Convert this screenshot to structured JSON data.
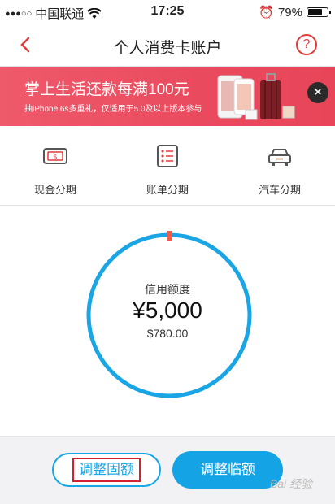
{
  "status_bar": {
    "carrier": "中国联通",
    "time": "17:25",
    "battery": "79%",
    "battery_level": 0.79
  },
  "nav": {
    "title": "个人消费卡账户",
    "help_symbol": "?"
  },
  "banner": {
    "title": "掌上生活还款每满100元",
    "subtitle": "抽iPhone 6s多重礼，仅适用于5.0及以上版本参与",
    "close_symbol": "×"
  },
  "services": [
    {
      "label": "现金分期",
      "icon": "cash-card-icon"
    },
    {
      "label": "账单分期",
      "icon": "bill-list-icon"
    },
    {
      "label": "汽车分期",
      "icon": "car-icon"
    }
  ],
  "credit": {
    "label": "信用额度",
    "amount": "¥5,000",
    "used": "$780.00",
    "ring_color": "#1aa6e4",
    "marker_color": "#f05a4a"
  },
  "actions": {
    "fixed_limit": "调整固额",
    "temp_limit": "调整临额"
  },
  "watermark": "Bai 经验",
  "colors": {
    "accent": "#17a6e6",
    "brand_red": "#e03c3c",
    "banner": "#ea4a5e"
  }
}
